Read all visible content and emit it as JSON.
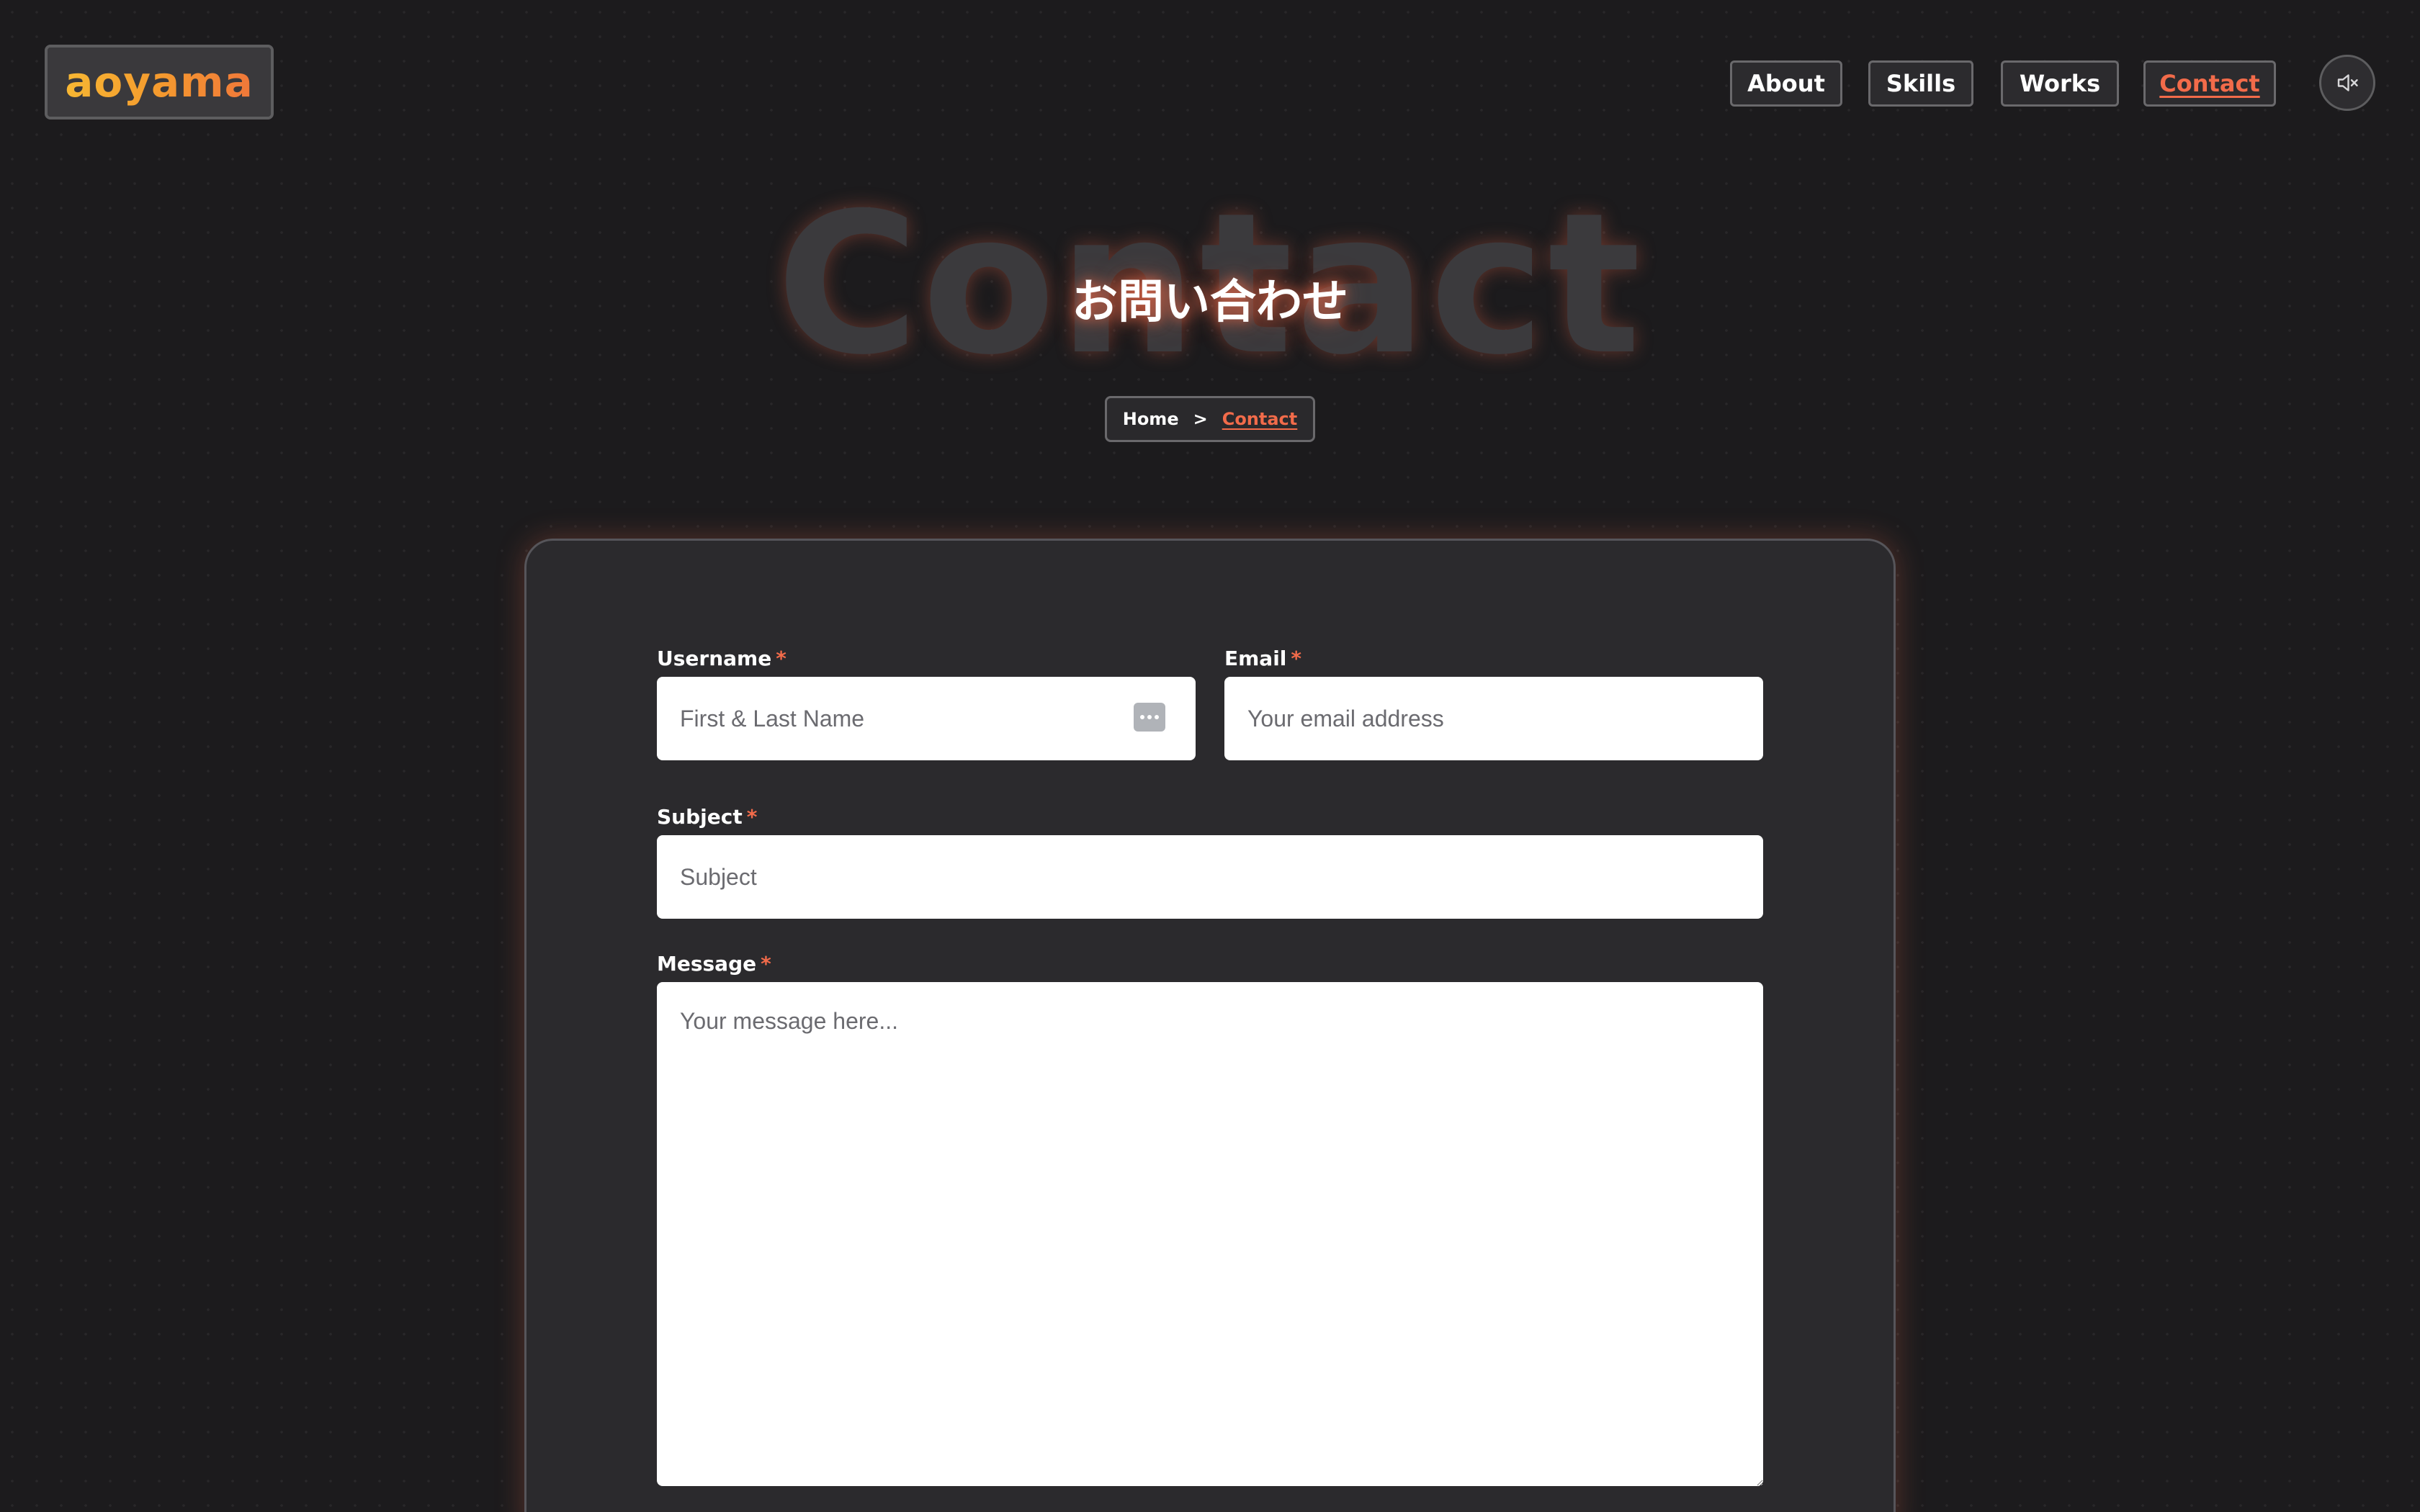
{
  "logo": {
    "text": "aoyama"
  },
  "nav": {
    "items": [
      {
        "label": "About"
      },
      {
        "label": "Skills"
      },
      {
        "label": "Works"
      },
      {
        "label": "Contact"
      }
    ],
    "active": "Contact",
    "mute_icon": "speaker-muted-icon"
  },
  "hero": {
    "background_title": "Contact",
    "title_jp": "お問い合わせ"
  },
  "breadcrumb": {
    "home": "Home",
    "separator": ">",
    "current": "Contact"
  },
  "form": {
    "username": {
      "label": "Username",
      "required": "*",
      "placeholder": "First & Last Name"
    },
    "email": {
      "label": "Email",
      "required": "*",
      "placeholder": "Your email address"
    },
    "subject": {
      "label": "Subject",
      "required": "*",
      "placeholder": "Subject"
    },
    "message": {
      "label": "Message",
      "required": "*",
      "placeholder": "Your message here..."
    }
  },
  "colors": {
    "accent": "#f26b4a",
    "logo_gradient_start": "#f7b733",
    "logo_gradient_end": "#f0773a",
    "background": "#1c1b1d",
    "card": "#2b2a2d"
  }
}
